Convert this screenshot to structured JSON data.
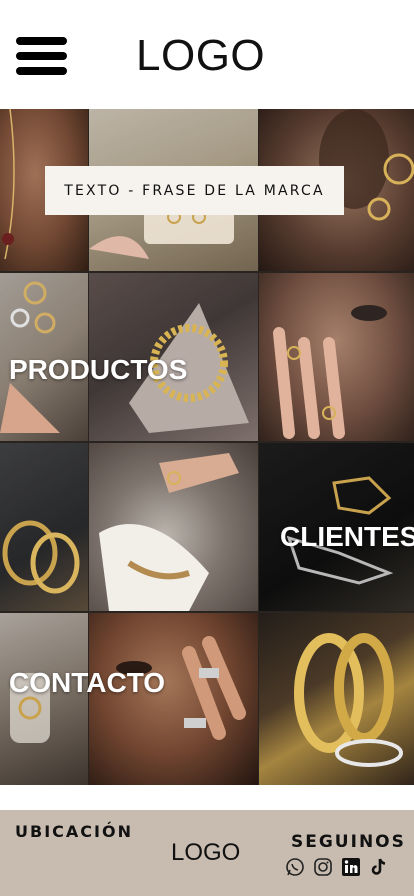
{
  "header": {
    "logo": "LOGO",
    "menu_icon": "hamburger-menu-icon"
  },
  "hero": {
    "tagline": "TEXTO - FRASE DE LA MARCA"
  },
  "sections": {
    "productos": "PRODUCTOS",
    "clientes": "CLIENTES",
    "contacto": "CONTACTO"
  },
  "footer": {
    "ubicacion": "UBICACIÓN",
    "logo": "LOGO",
    "seguinos": "SEGUINOS",
    "social_icons": [
      "whatsapp-icon",
      "instagram-icon",
      "linkedin-icon",
      "tiktok-icon"
    ]
  },
  "colors": {
    "footer_bg": "#c8bcb1",
    "tagline_bg": "#f6f3ef",
    "text_dark": "#111111",
    "label_text": "#ffffff"
  }
}
